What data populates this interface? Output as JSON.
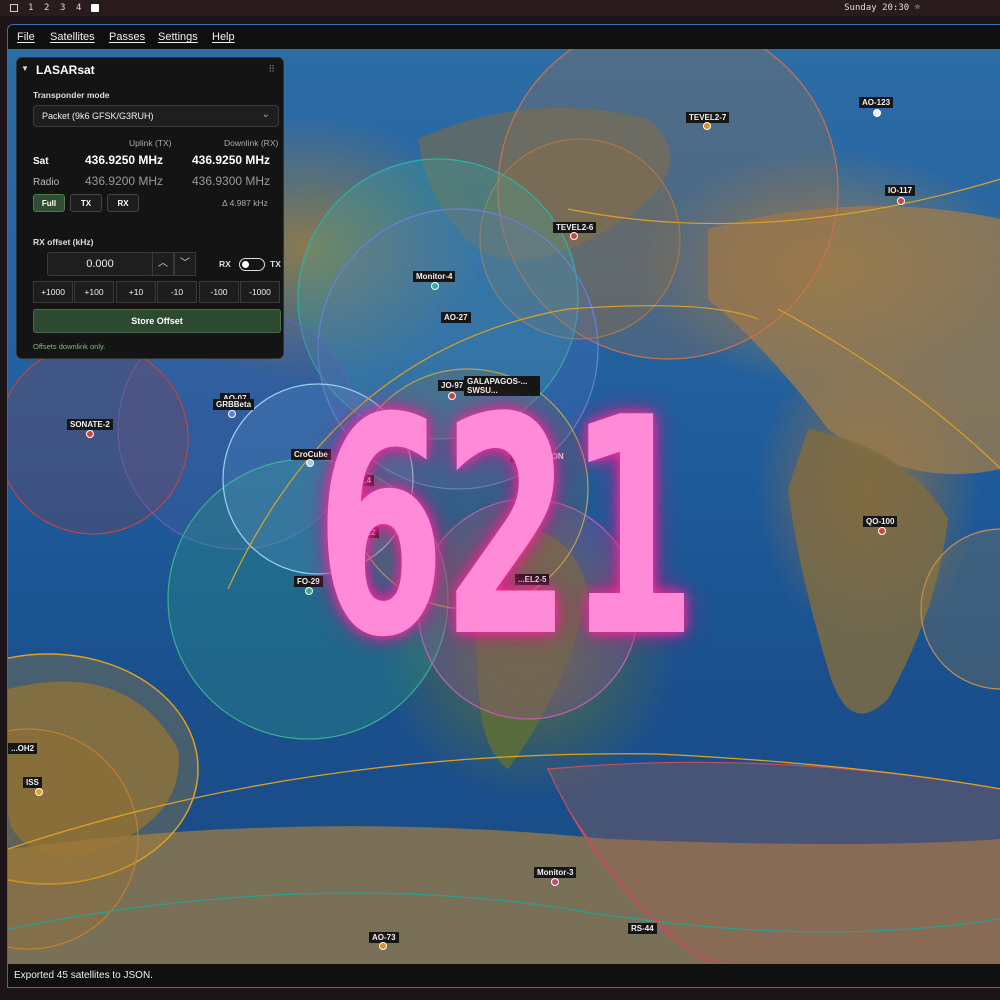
{
  "system_bar": {
    "workspaces": [
      "1",
      "2",
      "3",
      "4"
    ],
    "clock": "Sunday 20:30 ☼"
  },
  "menu": [
    "File",
    "Satellites",
    "Passes",
    "Settings",
    "Help"
  ],
  "panel": {
    "title": "LASARsat",
    "grip_icon": "⠿",
    "transponder_label": "Transponder mode",
    "transponder_value": "Packet (9k6 GFSK/G3RUH)",
    "uplink_header": "Uplink (TX)",
    "downlink_header": "Downlink (RX)",
    "sat_label": "Sat",
    "sat_uplink": "436.9250 MHz",
    "sat_downlink": "436.9250 MHz",
    "radio_label": "Radio",
    "radio_uplink": "436.9200 MHz",
    "radio_downlink": "436.9300 MHz",
    "buttons": [
      "Full",
      "TX",
      "RX"
    ],
    "delta": "Δ   4.987 kHz",
    "rx_offset_label": "RX offset (kHz)",
    "rx_offset_value": "0.000",
    "toggle_left": "RX",
    "toggle_right": "TX",
    "increments": [
      "+1000",
      "+100",
      "+10",
      "-10",
      "-100",
      "-1000"
    ],
    "store_label": "Store Offset",
    "hint": "Offsets downlink only."
  },
  "satellites": [
    "AO-123",
    "TEVEL2-7",
    "IO-117",
    "TEVEL2-6",
    "Monitor-4",
    "AO-27",
    "JO-97",
    "GALAPAGOS-... SWSU...",
    "AO-07",
    "GRBBeta",
    "SONATE-2",
    "CroCube",
    "...CUBE-...ON",
    "QO-100",
    "FO-29",
    "...EL2-5",
    "...OH2",
    "ISS",
    "Monitor-3",
    "RS-44",
    "AO-73",
    "...4",
    "...22"
  ],
  "overlay_number": "621",
  "status": "Exported 45 satellites to JSON.",
  "colors": {
    "accent_green": "#2f4e32",
    "window_border": "#3a6fb0",
    "overlay": "#ff8ad8"
  }
}
